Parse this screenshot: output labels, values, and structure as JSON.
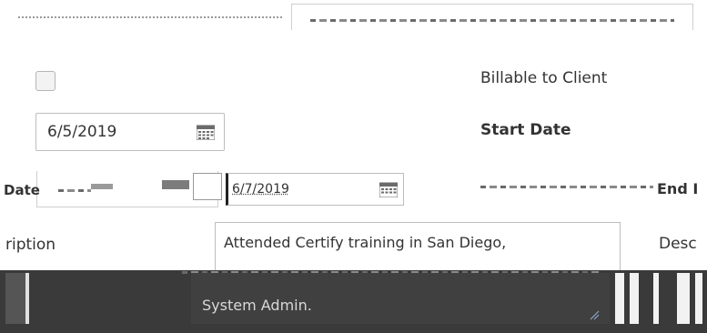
{
  "billable": {
    "label": "Billable to Client",
    "checked": false
  },
  "start_date": {
    "value": "6/5/2019",
    "label": "Start Date"
  },
  "end_date": {
    "left_label": "Date",
    "value": "6/7/2019",
    "right_label": "End I"
  },
  "description": {
    "left_label": "ription",
    "value": "Attended Certify training in San Diego,",
    "right_label": "Desc"
  },
  "role_field": {
    "value": "System Admin."
  },
  "icons": {
    "calendar": "calendar-icon",
    "resize": "resize-grip-icon"
  },
  "colors": {
    "border": "#bdbdbd",
    "dark_band": "#3a3a3a",
    "text": "#333333"
  }
}
